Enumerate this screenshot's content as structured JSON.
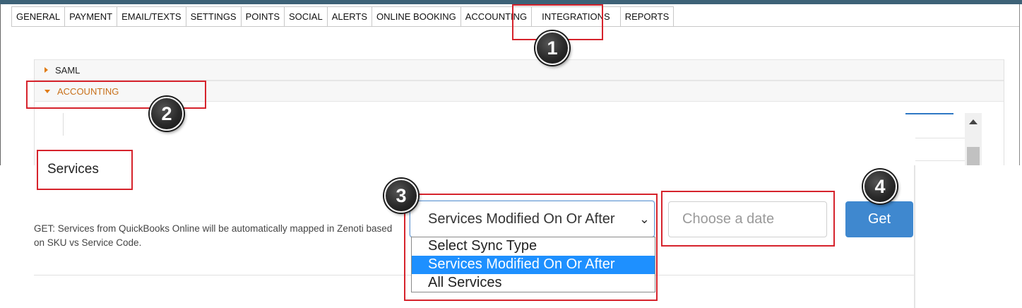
{
  "tabs": [
    {
      "label": "GENERAL"
    },
    {
      "label": "PAYMENT"
    },
    {
      "label": "EMAIL/TEXTS"
    },
    {
      "label": "SETTINGS"
    },
    {
      "label": "POINTS"
    },
    {
      "label": "SOCIAL"
    },
    {
      "label": "ALERTS"
    },
    {
      "label": "ONLINE BOOKING"
    },
    {
      "label": "ACCOUNTING"
    },
    {
      "label": "INTEGRATIONS",
      "active": true
    },
    {
      "label": "REPORTS"
    }
  ],
  "accordion": {
    "saml_label": "SAML",
    "accounting_label": "ACCOUNTING"
  },
  "services": {
    "title": "Services",
    "description": "GET: Services from QuickBooks Online will be automatically mapped in Zenoti based on SKU vs Service Code.",
    "sync_type_selected": "Services Modified On Or After",
    "sync_type_options": [
      "Select Sync Type",
      "Services Modified On Or After",
      "All Services"
    ],
    "date_placeholder": "Choose a date",
    "get_button_label": "Get"
  },
  "callouts": {
    "step1": "1",
    "step2": "2",
    "step3": "3",
    "step4": "4"
  },
  "colors": {
    "highlight": "#d6232c",
    "accent_orange": "#e07b16",
    "button_blue": "#3f88cf",
    "option_selected": "#1e90ff",
    "topbar": "#3d6277"
  }
}
